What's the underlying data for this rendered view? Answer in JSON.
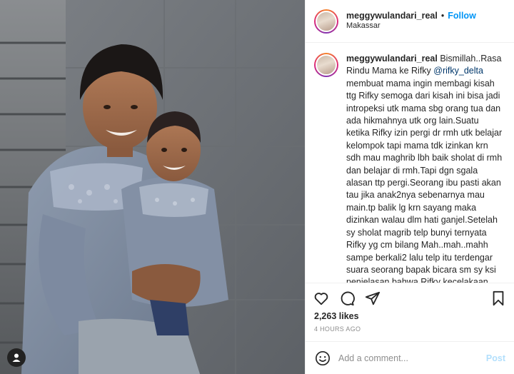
{
  "header": {
    "username": "meggywulandari_real",
    "separator": "•",
    "follow_label": "Follow",
    "location": "Makassar"
  },
  "caption": {
    "username": "meggywulandari_real",
    "text_before": "Bismillah..Rasa Rindu Mama ke Rifky ",
    "mention": "@rifky_delta",
    "text_after": " membuat mama ingin membagi kisah ttg Rifky semoga dari kisah ini bisa jadi intropeksi utk mama sbg orang tua dan ada hikmahnya utk org lain.Suatu ketika Rifky izin pergi dr rmh utk belajar kelompok tapi mama tdk izinkan krn sdh mau maghrib lbh baik sholat di rmh dan belajar di rmh.Tapi dgn sgala alasan ttp pergi.Seorang ibu pasti akan tau jika anak2nya sebenarnya mau main.tp balik lg krn sayang maka dizinkan walau dlm hati ganjel.Setelah sy sholat magrib telp bunyi ternyata Rifky yg cm bilang Mah..mah..mahh sampe berkali2 lalu telp itu terdengar suara seorang bapak bicara sm sy ksi penjelasan bahwa Rifky kecelakaan motor.Sy sm terus"
  },
  "icons": {
    "like": "heart-icon",
    "comment": "comment-icon",
    "share": "paper-plane-icon",
    "save": "bookmark-icon",
    "emoji": "smiley-icon",
    "tag": "user-tag-icon"
  },
  "stats": {
    "likes": "2,263 likes",
    "time": "4 HOURS AGO"
  },
  "comment": {
    "placeholder": "Add a comment...",
    "post_label": "Post"
  },
  "colors": {
    "accent": "#0095f6",
    "post_disabled": "#b2dffc",
    "secondary_text": "#8e8e8e"
  }
}
